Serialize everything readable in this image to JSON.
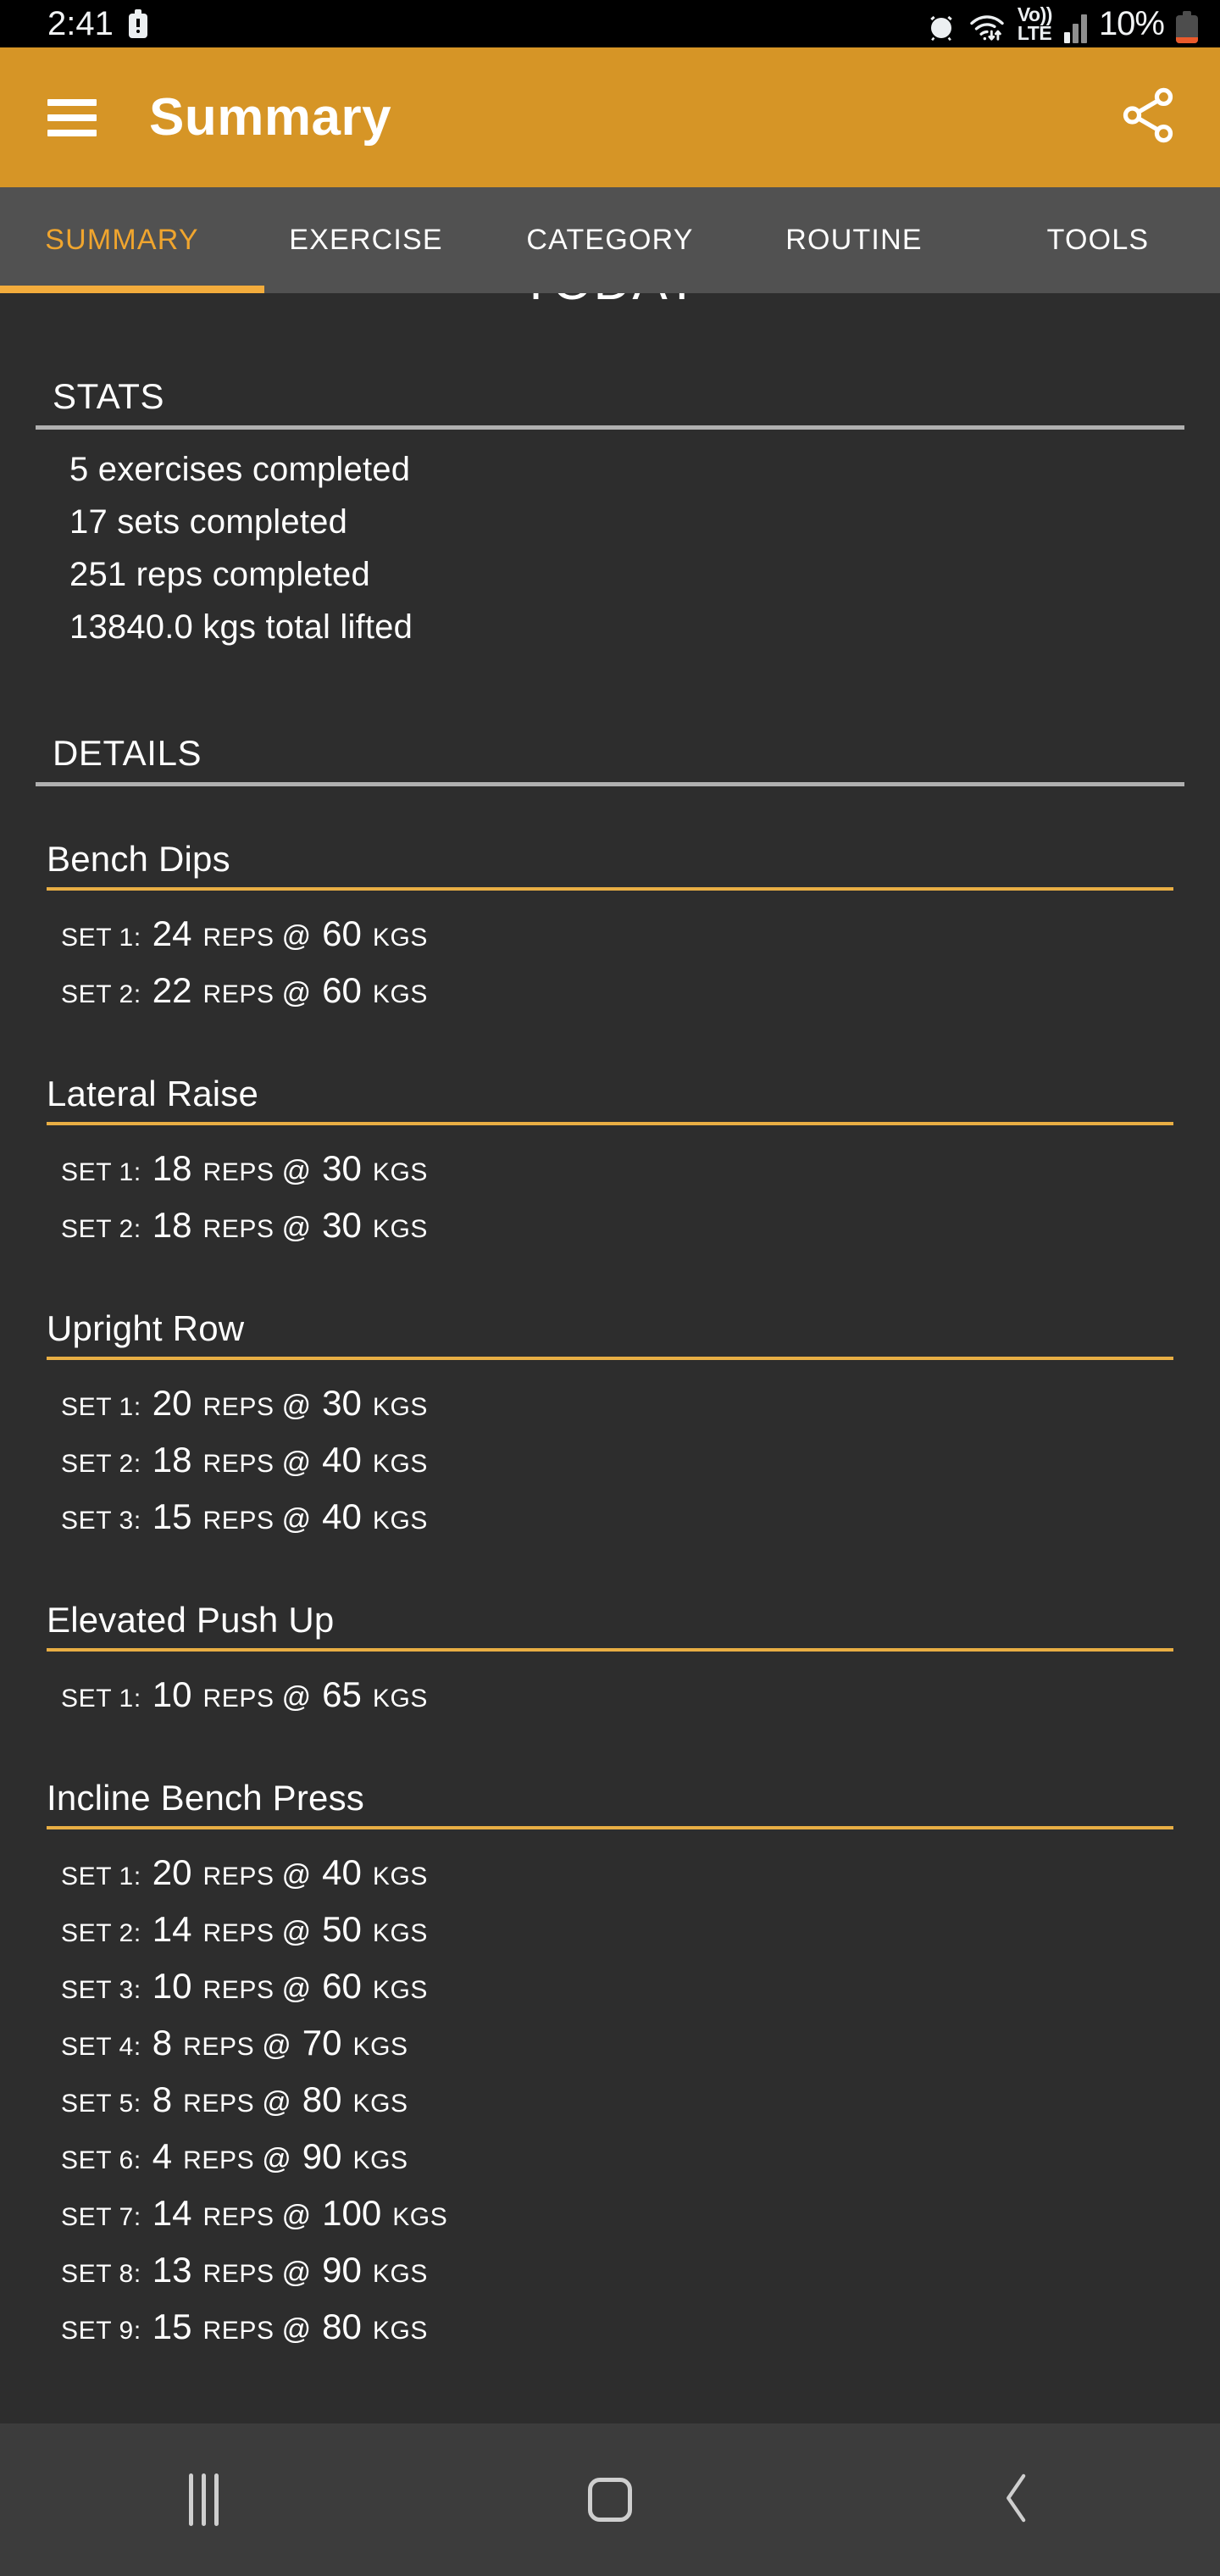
{
  "status_bar": {
    "time": "2:41",
    "battery_warning_icon": "battery-alert-icon",
    "alarm_icon": "alarm-clock-icon",
    "wifi_icon": "wifi-data-transfer-icon",
    "volte_line1": "Vo))",
    "volte_line2": "LTE",
    "signal_icon": "cellular-signal-icon",
    "battery_percent": "10%",
    "battery_icon": "battery-low-icon"
  },
  "app_bar": {
    "menu_icon": "hamburger-menu-icon",
    "title": "Summary",
    "share_icon": "share-icon",
    "background_color": "#d69526"
  },
  "tabs": {
    "items": [
      {
        "label": "SUMMARY",
        "active": true
      },
      {
        "label": "EXERCISE",
        "active": false
      },
      {
        "label": "CATEGORY",
        "active": false
      },
      {
        "label": "ROUTINE",
        "active": false
      },
      {
        "label": "TOOLS",
        "active": false
      }
    ],
    "active_color": "#f0a52e",
    "indicator_color": "#f3ac3c",
    "background_color": "#515151"
  },
  "main": {
    "page_title": "TODAY",
    "stats_heading": "STATS",
    "stats": [
      "5 exercises completed",
      "17 sets completed",
      "251 reps completed",
      "13840.0 kgs total lifted"
    ],
    "details_heading": "DETAILS",
    "reps_word": "REPS @",
    "unit_word": "KGS",
    "exercises": [
      {
        "name": "Bench Dips",
        "sets": [
          {
            "label": "SET 1:",
            "reps": "24",
            "weight": "60"
          },
          {
            "label": "SET 2:",
            "reps": "22",
            "weight": "60"
          }
        ]
      },
      {
        "name": "Lateral Raise",
        "sets": [
          {
            "label": "SET 1:",
            "reps": "18",
            "weight": "30"
          },
          {
            "label": "SET 2:",
            "reps": "18",
            "weight": "30"
          }
        ]
      },
      {
        "name": "Upright Row",
        "sets": [
          {
            "label": "SET 1:",
            "reps": "20",
            "weight": "30"
          },
          {
            "label": "SET 2:",
            "reps": "18",
            "weight": "40"
          },
          {
            "label": "SET 3:",
            "reps": "15",
            "weight": "40"
          }
        ]
      },
      {
        "name": "Elevated Push Up",
        "sets": [
          {
            "label": "SET 1:",
            "reps": "10",
            "weight": "65"
          }
        ]
      },
      {
        "name": "Incline Bench Press",
        "sets": [
          {
            "label": "SET 1:",
            "reps": "20",
            "weight": "40"
          },
          {
            "label": "SET 2:",
            "reps": "14",
            "weight": "50"
          },
          {
            "label": "SET 3:",
            "reps": "10",
            "weight": "60"
          },
          {
            "label": "SET 4:",
            "reps": "8",
            "weight": "70"
          },
          {
            "label": "SET 5:",
            "reps": "8",
            "weight": "80"
          },
          {
            "label": "SET 6:",
            "reps": "4",
            "weight": "90"
          },
          {
            "label": "SET 7:",
            "reps": "14",
            "weight": "100"
          },
          {
            "label": "SET 8:",
            "reps": "13",
            "weight": "90"
          },
          {
            "label": "SET 9:",
            "reps": "15",
            "weight": "80"
          }
        ]
      }
    ]
  },
  "nav_bar": {
    "recents_icon": "recents-icon",
    "home_icon": "home-icon",
    "back_icon": "back-chevron-icon"
  }
}
